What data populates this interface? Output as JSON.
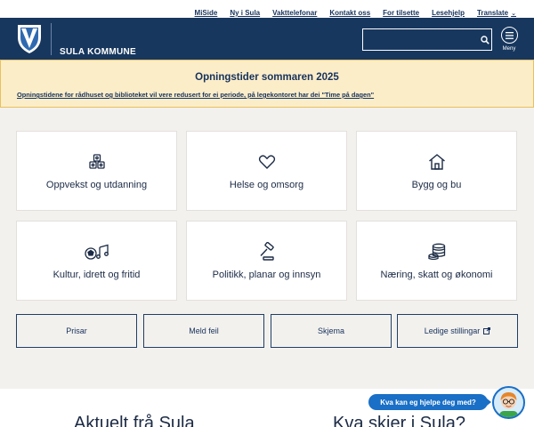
{
  "top_links": [
    {
      "label": "MiSide"
    },
    {
      "label": "Ny i Sula"
    },
    {
      "label": "Vakttelefonar"
    },
    {
      "label": "Kontakt oss"
    },
    {
      "label": "For tilsette"
    },
    {
      "label": "Lesehjelp"
    },
    {
      "label": "Translate",
      "icon": "chevron-down-icon"
    }
  ],
  "header": {
    "site_name": "SULA KOMMUNE",
    "search_placeholder": "",
    "menu_label": "Meny"
  },
  "notice": {
    "title": "Opningstider sommaren 2025",
    "text": "Opningstidene for rådhuset og biblioteket vil vere redusert for ei periode, på legekontoret har dei \"Time på dagen\""
  },
  "services": [
    {
      "label": "Oppvekst og utdanning",
      "icon": "blocks-icon"
    },
    {
      "label": "Helse og omsorg",
      "icon": "heart-icon"
    },
    {
      "label": "Bygg og bu",
      "icon": "house-icon"
    },
    {
      "label": "Kultur, idrett og fritid",
      "icon": "ball-music-icon"
    },
    {
      "label": "Politikk, planar og innsyn",
      "icon": "gavel-icon"
    },
    {
      "label": "Næring, skatt og økonomi",
      "icon": "coins-icon"
    }
  ],
  "quick_buttons": [
    {
      "label": "Prisar"
    },
    {
      "label": "Meld feil"
    },
    {
      "label": "Skjema"
    },
    {
      "label": "Ledige stillingar",
      "icon": "external-link-icon"
    }
  ],
  "sections": {
    "news_title": "Aktuelt frå Sula",
    "events_title": "Kva skjer i Sula?"
  },
  "chat": {
    "prompt": "Kva kan eg hjelpe deg med?"
  },
  "colors": {
    "header_bg": "#17375e",
    "notice_bg": "#fcedc9",
    "accent_blue": "#1a6fc6"
  }
}
